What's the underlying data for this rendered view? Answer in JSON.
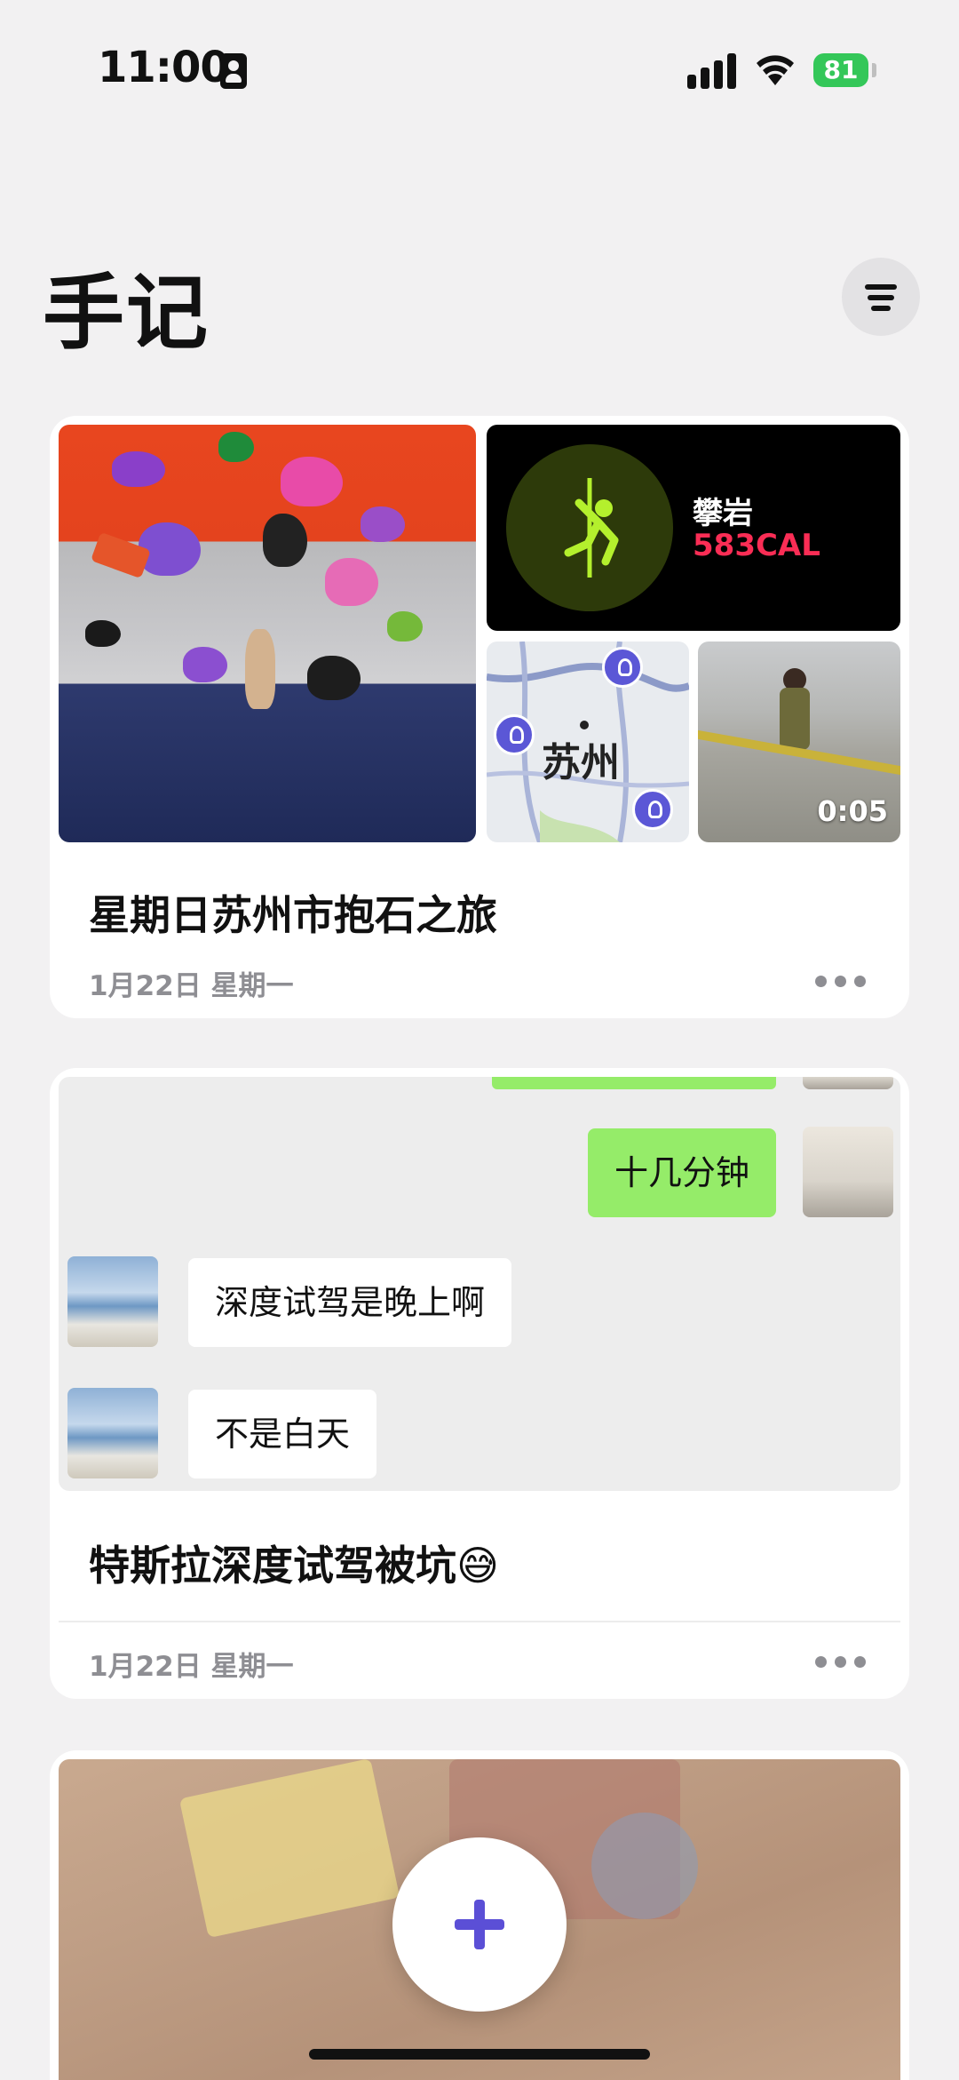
{
  "status_bar": {
    "time": "11:00",
    "battery": "81"
  },
  "header": {
    "title": "手记"
  },
  "entries": [
    {
      "title": "星期日苏州市抱石之旅",
      "date": "1月22日 星期一",
      "workout": {
        "name": "攀岩",
        "calories": "583CAL"
      },
      "map": {
        "city": "苏州"
      },
      "video": {
        "duration": "0:05"
      }
    },
    {
      "title": "特斯拉深度试驾被坑😅",
      "date": "1月22日 星期一",
      "chat": {
        "sent": "十几分钟",
        "received": [
          "深度试驾是晚上啊",
          "不是白天"
        ]
      }
    },
    {
      "title": "",
      "date": ""
    }
  ],
  "colors": {
    "accent": "#5b4fd6",
    "calories": "#fa2d55",
    "chat_green": "#95ec69",
    "battery": "#34c759"
  },
  "icons": {
    "filter": "filter-icon",
    "add": "plus-icon",
    "more": "more-icon",
    "workout": "pole-climb-icon",
    "map_pin": "map-pin-icon"
  }
}
